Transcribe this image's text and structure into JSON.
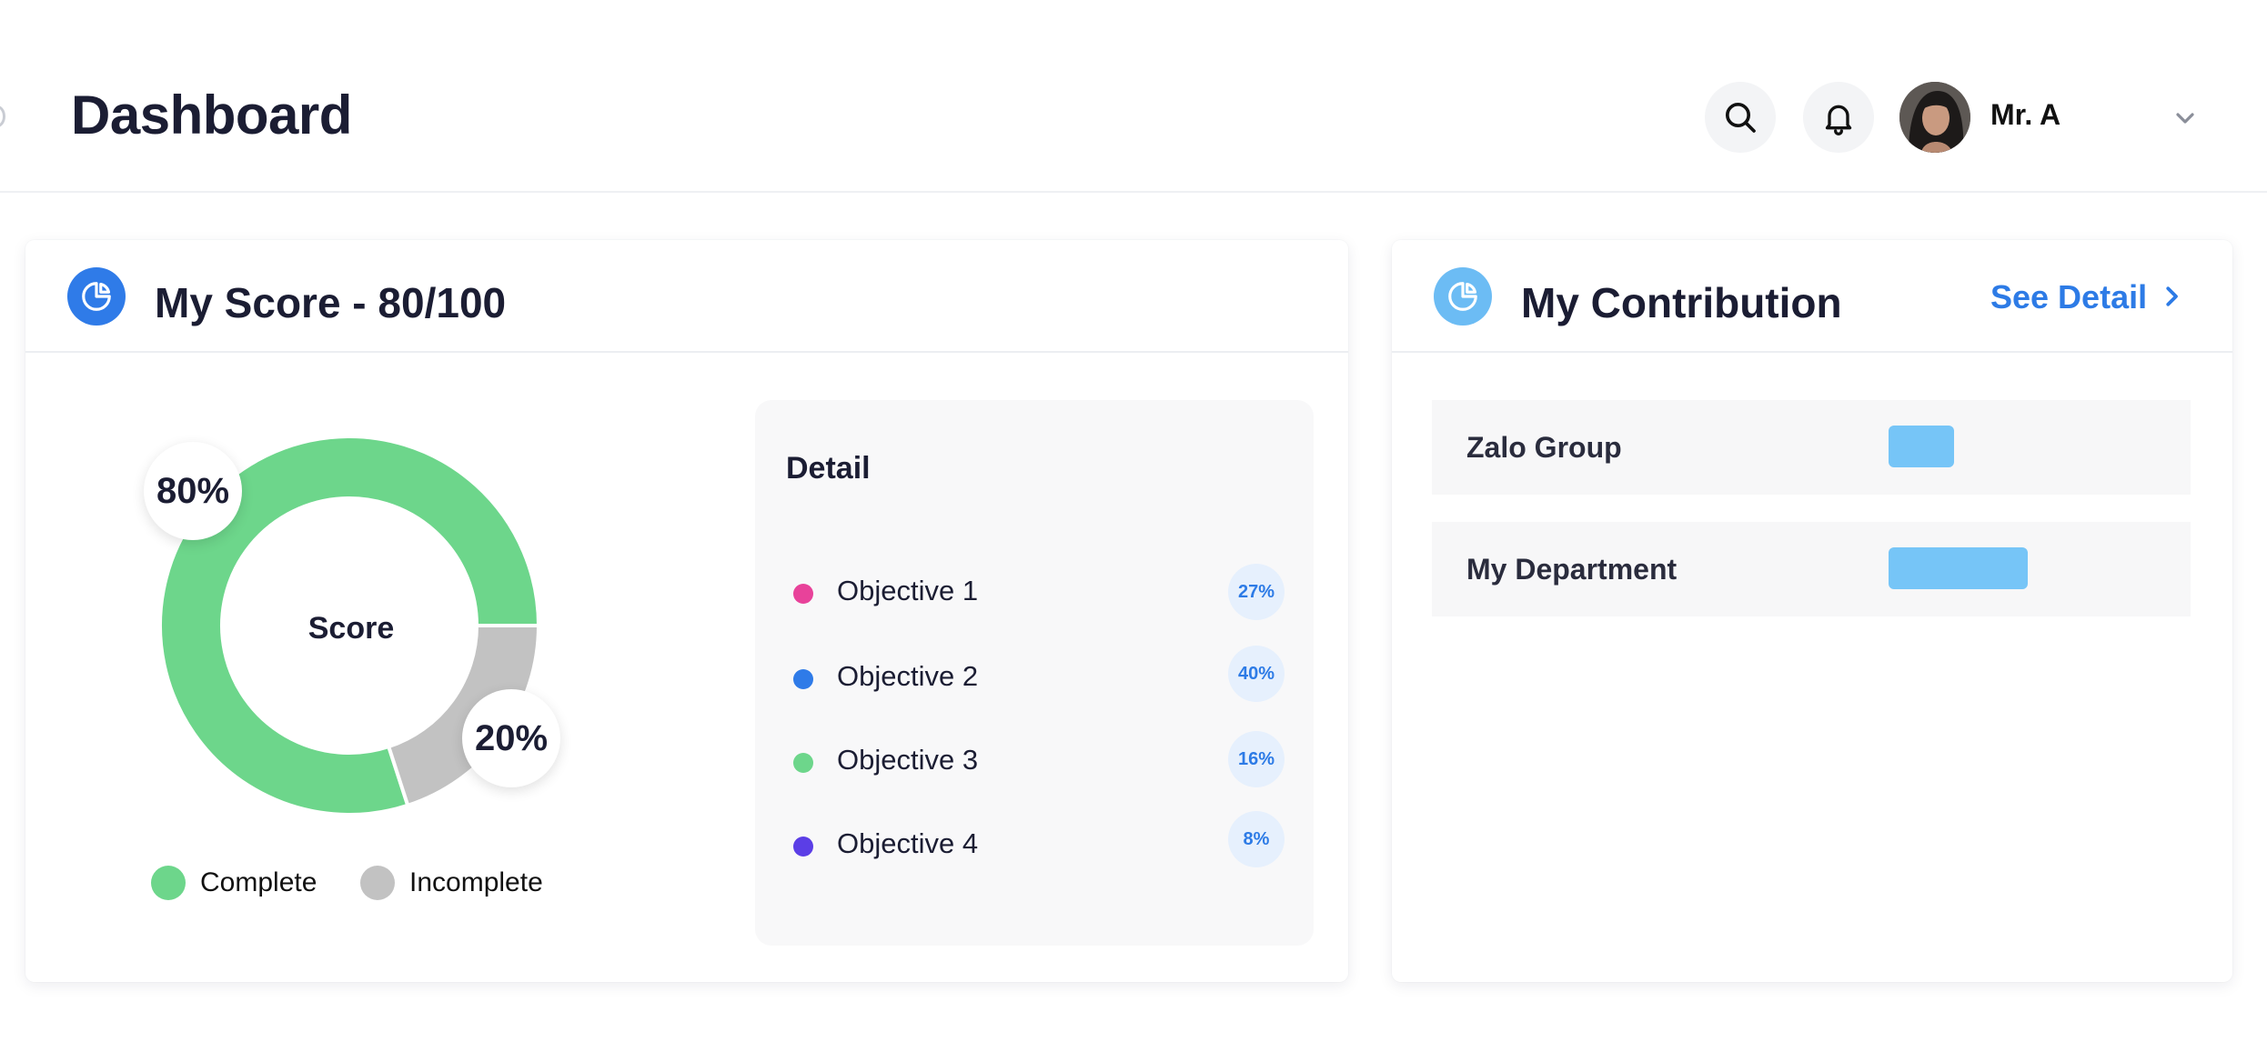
{
  "header": {
    "title": "Dashboard",
    "user_name": "Mr. A"
  },
  "score_card": {
    "title": "My Score - 80/100",
    "center_label": "Score",
    "complete_pct": "80%",
    "incomplete_pct": "20%",
    "legend": [
      {
        "label": "Complete",
        "color": "#6dd68b"
      },
      {
        "label": "Incomplete",
        "color": "#c2c2c2"
      }
    ],
    "detail": {
      "title": "Detail",
      "objectives": [
        {
          "label": "Objective 1",
          "value": "27%",
          "color": "#e8429a"
        },
        {
          "label": "Objective 2",
          "value": "40%",
          "color": "#2f7be8"
        },
        {
          "label": "Objective 3",
          "value": "16%",
          "color": "#6dd68b"
        },
        {
          "label": "Objective 4",
          "value": "8%",
          "color": "#5b3ee6"
        }
      ]
    }
  },
  "contribution_card": {
    "title": "My Contribution",
    "see_detail": "See Detail",
    "rows": [
      {
        "label": "Zalo Group",
        "level": 0.24
      },
      {
        "label": "My Department",
        "level": 0.51
      }
    ]
  },
  "colors": {
    "accent": "#2d7be6",
    "score_icon_bg": "#2f7be8",
    "contribution_icon_bg": "#6cbcf4",
    "complete": "#6dd68b",
    "incomplete": "#c2c2c2",
    "bar": "#76c5f7"
  },
  "icons": {
    "search": "search-icon",
    "notification": "bell-icon",
    "dropdown": "chevron-down-icon",
    "section": "pie-chart-icon",
    "link": "chevron-right-icon"
  },
  "chart_data": {
    "type": "pie",
    "categories": [
      "Complete",
      "Incomplete"
    ],
    "values": [
      80,
      20
    ],
    "title": "",
    "center_label": "Score"
  }
}
